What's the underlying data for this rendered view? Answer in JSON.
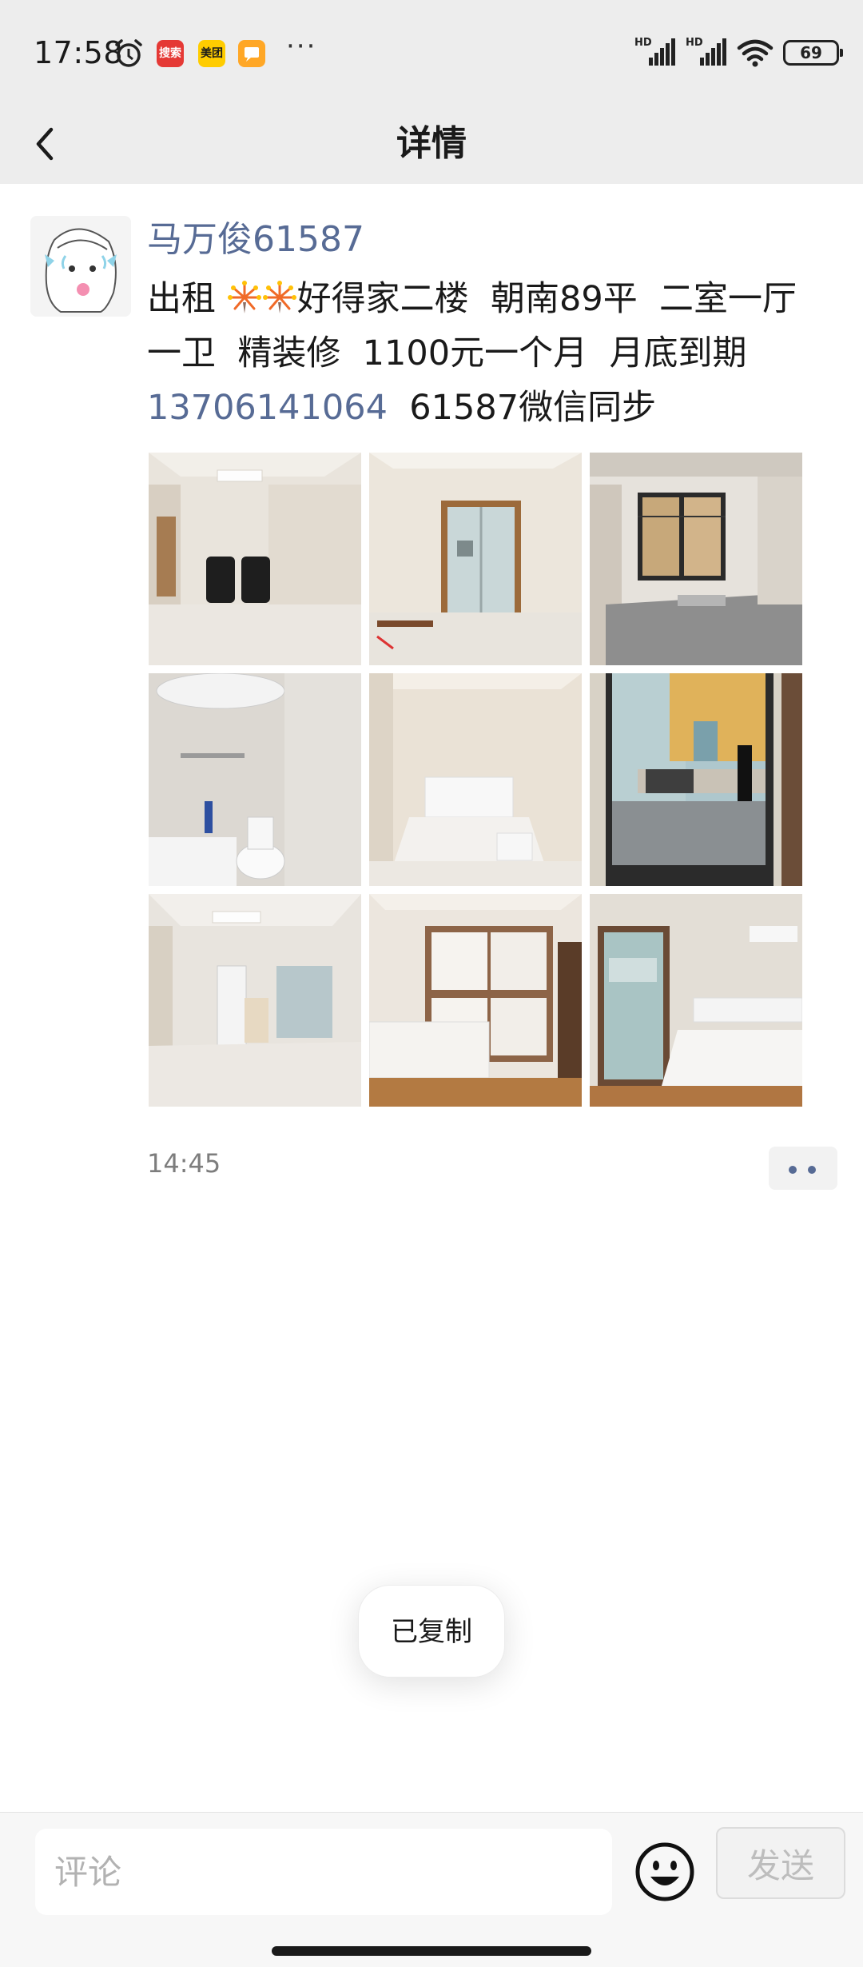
{
  "status_bar": {
    "time": "17:58",
    "app_badges": [
      "搜索",
      "美团"
    ],
    "more": "···",
    "battery": "69",
    "hd_label": "HD"
  },
  "header": {
    "title": "详情",
    "back_icon": "chevron-left-icon"
  },
  "post": {
    "author": "马万俊61587",
    "text_before_emoji": "出租 ",
    "emoji": [
      "fireworks",
      "fireworks"
    ],
    "text_line": "好得家二楼  朝南89平  二室一厅一卫  精装修  1100元一个月  月底到期",
    "phone": "13706141064",
    "text_after_phone": "  61587微信同步",
    "time": "14:45",
    "images": [
      "living-room-massage-chairs",
      "hallway-to-kitchen",
      "kitchen-window-sink",
      "bathroom-water-heater",
      "bedroom-bed",
      "balcony-door-street",
      "living-room-air-conditioner",
      "bedroom-wardrobe",
      "bedroom-balcony"
    ]
  },
  "toast": {
    "text": "已复制"
  },
  "comment_bar": {
    "placeholder": "评论",
    "send_label": "发送",
    "emoji_icon": "smiley-icon"
  },
  "colors": {
    "bar_bg": "#ededed",
    "link_blue": "#576b95",
    "time_gray": "#7d7d7d"
  }
}
